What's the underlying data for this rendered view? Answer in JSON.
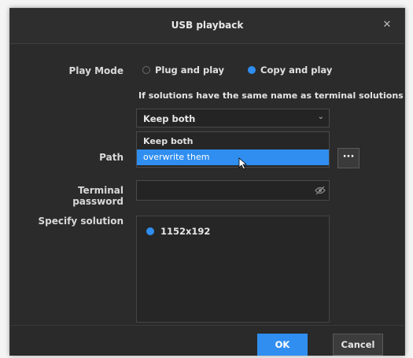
{
  "dialog": {
    "title": "USB playback",
    "close_icon": "close-icon"
  },
  "play_mode": {
    "label": "Play Mode",
    "options": [
      {
        "label": "Plug and play",
        "checked": false
      },
      {
        "label": "Copy and play",
        "checked": true
      }
    ]
  },
  "same_name": {
    "hint": "If solutions have the same name as terminal solutions",
    "selected_value": "Keep both",
    "chevron_icon": "chevron-down-icon",
    "options": [
      {
        "label": "Keep both",
        "highlighted": false
      },
      {
        "label": "overwrite them",
        "highlighted": true
      }
    ]
  },
  "path": {
    "label": "Path",
    "browse_label": "···"
  },
  "terminal_password": {
    "label": "Terminal password",
    "value": "",
    "placeholder": "",
    "eye_icon": "eye-icon"
  },
  "specify_solution": {
    "label": "Specify solution",
    "items": [
      {
        "label": "1152x192",
        "checked": true
      }
    ]
  },
  "footer": {
    "ok_label": "OK",
    "cancel_label": "Cancel"
  },
  "colors": {
    "accent": "#2f8ef0",
    "background": "#2b2b2b"
  }
}
